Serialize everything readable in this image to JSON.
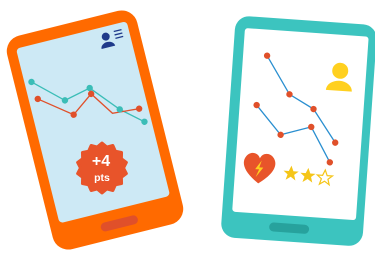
{
  "illustration": {
    "left_phone": {
      "frame_color": "#ff6a00",
      "screen_color": "#cde9f5",
      "icons": [
        "user-icon",
        "menu-lines-icon"
      ],
      "badge": {
        "value": "+4",
        "unit": "pts",
        "color": "#e8542a"
      },
      "chart_lines": {
        "teal_color": "#3bbdb7",
        "red_color": "#e0502a"
      }
    },
    "right_phone": {
      "frame_color": "#3cc4bf",
      "screen_color": "#ffffff",
      "icons": [
        "user-icon",
        "heart-bolt-icon",
        "star-icon"
      ],
      "avatar_color": "#ffd01f",
      "heart_color": "#e8542a",
      "rating": {
        "filled": 2,
        "total": 3,
        "color": "#f5c518"
      },
      "chart_lines": {
        "blue_color": "#2a8fd0",
        "red_color": "#e0502a"
      }
    }
  }
}
